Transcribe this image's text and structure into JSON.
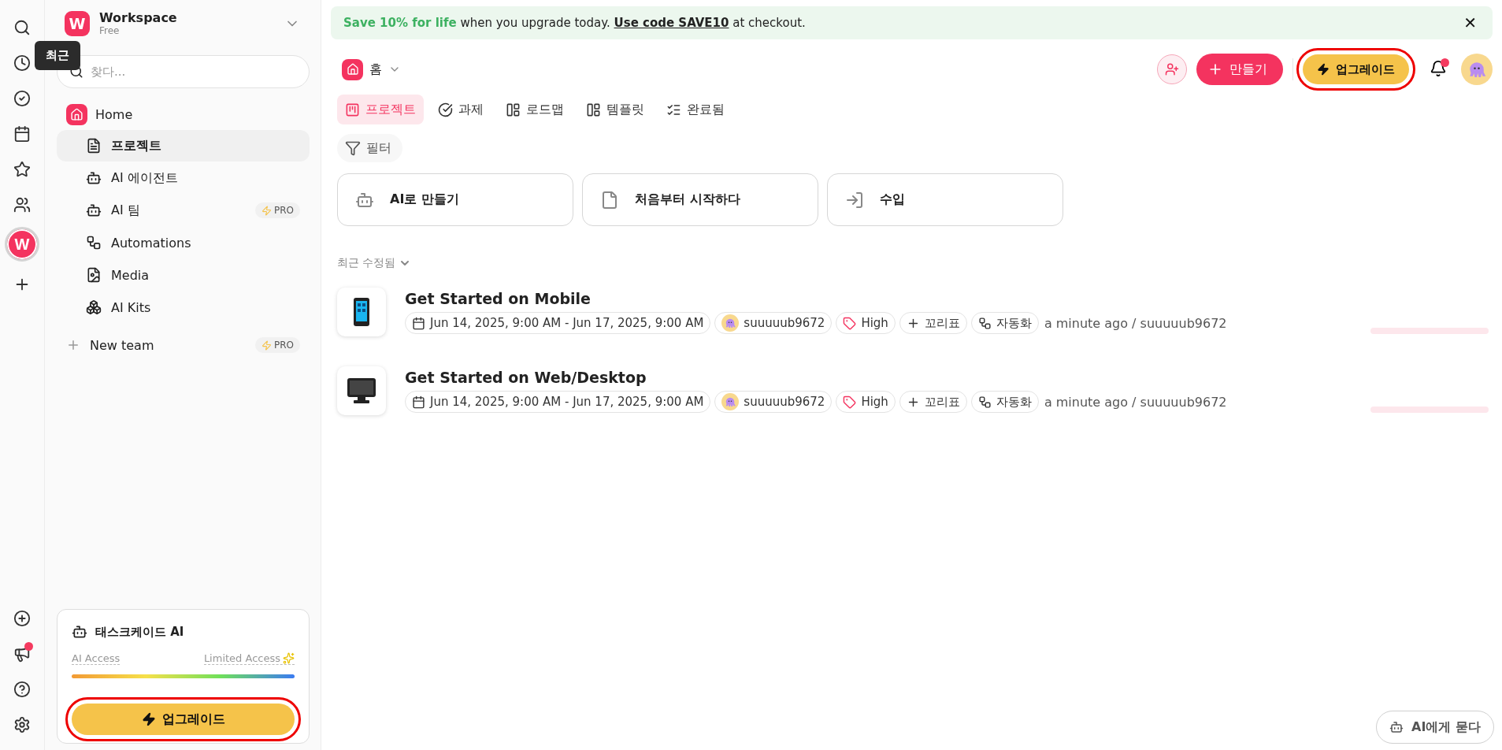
{
  "tooltip": {
    "text": "최근"
  },
  "rail": {
    "workspace_initial": "W",
    "announcement_dot": true
  },
  "workspace": {
    "initial": "W",
    "name": "Workspace",
    "plan": "Free"
  },
  "search": {
    "placeholder": "찾다..."
  },
  "home": {
    "label": "Home"
  },
  "nav": [
    {
      "kind": "project",
      "label": "프로젝트",
      "selected": true
    },
    {
      "kind": "agent",
      "label": "AI 에이전트",
      "selected": false
    },
    {
      "kind": "team",
      "label": "AI 팀",
      "selected": false,
      "badge": "PRO"
    },
    {
      "kind": "automation",
      "label": "Automations",
      "selected": false
    },
    {
      "kind": "media",
      "label": "Media",
      "selected": false
    },
    {
      "kind": "kits",
      "label": "AI Kits",
      "selected": false
    }
  ],
  "new_team": {
    "label": "New team",
    "badge": "PRO"
  },
  "ai_panel": {
    "title": "태스크케이드 AI",
    "access_label": "AI Access",
    "access_value": "Limited Access",
    "upgrade": "업그레이드",
    "highlighted": true
  },
  "banner": {
    "text": "**Save 10% for life** when you upgrade today. **Use code SAVE10** at checkout.",
    "close": "✕"
  },
  "header": {
    "breadcrumb": "홈",
    "create": "만들기",
    "upgrade": "업그레이드",
    "upgrade_highlighted": true,
    "notification_dot": true
  },
  "tabs": [
    {
      "kind": "project",
      "label": "프로젝트",
      "selected": true
    },
    {
      "kind": "task",
      "label": "과제",
      "selected": false
    },
    {
      "kind": "roadmap",
      "label": "로드맵",
      "selected": false
    },
    {
      "kind": "template",
      "label": "템플릿",
      "selected": false
    },
    {
      "kind": "done",
      "label": "완료됨",
      "selected": false
    }
  ],
  "filter": "필터",
  "actions": [
    {
      "kind": "ai",
      "label": "AI로 만들기"
    },
    {
      "kind": "blank",
      "label": "처음부터 시작하다"
    },
    {
      "kind": "import",
      "label": "수입"
    }
  ],
  "section_title": "최근 수정됨",
  "projects": [
    {
      "kind": "mobile",
      "title": "Get Started on Mobile",
      "date": "Jun 14, 2025, 9:00 AM - Jun 17, 2025, 9:00 AM",
      "assignee": "suuuuub9672",
      "priority": "High",
      "tag": "꼬리표",
      "automation": "자동화",
      "updated": "a minute ago / suuuuub9672",
      "progress": {
        "level": 0
      }
    },
    {
      "kind": "desktop",
      "title": "Get Started on Web/Desktop",
      "date": "Jun 14, 2025, 9:00 AM - Jun 17, 2025, 9:00 AM",
      "assignee": "suuuuub9672",
      "priority": "High",
      "tag": "꼬리표",
      "automation": "자동화",
      "updated": "a minute ago / suuuuub9672",
      "progress": {
        "level": 0
      }
    }
  ],
  "ask_ai": "AI에게 묻다"
}
